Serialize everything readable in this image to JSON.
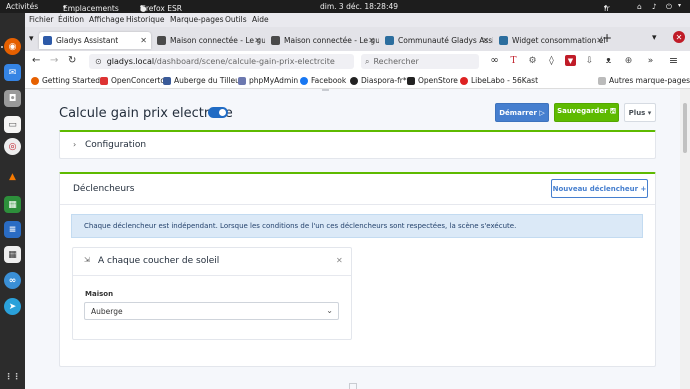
{
  "system": {
    "activities": "Activités",
    "places": "Emplacements",
    "app": "Firefox ESR",
    "datetime": "dim. 3 déc.  18:28:49",
    "lang": "fr"
  },
  "menu": [
    "Fichier",
    "Édition",
    "Affichage",
    "Historique",
    "Marque-pages",
    "Outils",
    "Aide"
  ],
  "tabs": [
    {
      "label": "Gladys Assistant",
      "color": "#2d5aa8"
    },
    {
      "label": "Maison connectée - Le gu",
      "color": "#4a4a4a"
    },
    {
      "label": "Maison connectée - Le gu",
      "color": "#4a4a4a"
    },
    {
      "label": "Communauté Gladys Assi",
      "color": "#2c6e9e"
    },
    {
      "label": "Widget consommation él",
      "color": "#2c6e9e"
    }
  ],
  "new_tab": "+",
  "url": {
    "host": "gladys.local",
    "path": "/dashboard/scene/calcule-gain-prix-electrcite"
  },
  "search_placeholder": "Rechercher",
  "bookmarks": [
    {
      "label": "Getting Started",
      "color": "#e66000"
    },
    {
      "label": "OpenConcerto",
      "color": "#d33"
    },
    {
      "label": "Auberge du Tilleul",
      "color": "#3a5a98"
    },
    {
      "label": "phpMyAdmin",
      "color": "#6c78af"
    },
    {
      "label": "Facebook",
      "color": "#1877f2"
    },
    {
      "label": "Diaspora-fr*",
      "color": "#222"
    },
    {
      "label": "OpenStore",
      "color": "#222"
    },
    {
      "label": "LibeLabo - 56Kast",
      "color": "#d22"
    }
  ],
  "other_bookmarks": "Autres marque-pages",
  "scene": {
    "title": "Calcule gain prix electrcite",
    "enabled": true,
    "start_button": "Démarrer ▷",
    "save_button": "Sauvegarder 🖫",
    "more_button": "Plus ▾",
    "configuration": "Configuration",
    "triggers_title": "Déclencheurs",
    "new_trigger_button": "Nouveau déclencheur +",
    "info_alert": "Chaque déclencheur est indépendant. Lorsque les conditions de l'un ces déclencheurs sont respectées, la scène s'exécute.",
    "trigger": {
      "title": "A chaque coucher de soleil",
      "house_label": "Maison",
      "house_value": "Auberge"
    }
  },
  "colors": {
    "primary": "#467fcf",
    "success": "#5eba00",
    "accent_toggle": "#206bc4"
  }
}
